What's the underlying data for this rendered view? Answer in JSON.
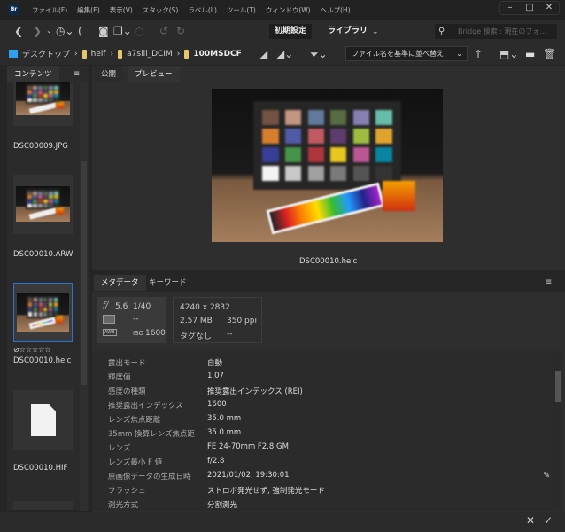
{
  "app": {
    "logo": "Br",
    "menu": [
      "ファイル(F)",
      "編集(E)",
      "表示(V)",
      "スタック(S)",
      "ラベル(L)",
      "ツール(T)",
      "ウィンドウ(W)",
      "ヘルプ(H)"
    ]
  },
  "toolbar": {
    "workspace_essentials": "初期設定",
    "workspace_library": "ライブラリ",
    "search_placeholder": "Bridge 検索 : 現在のフォ..."
  },
  "path": {
    "crumbs": [
      "デスクトップ",
      "heif",
      "a7siii_DCIM",
      "100MSDCF"
    ],
    "sort_label": "ファイル名を基準に並べ替え"
  },
  "content_panel": {
    "tab": "コンテンツ",
    "items": [
      {
        "name": "DSC00009.JPG"
      },
      {
        "name": "DSC00010.ARW"
      },
      {
        "name": "DSC00010.heic",
        "selected": true,
        "rating": "☆☆☆☆☆"
      },
      {
        "name": "DSC00010.HIF"
      }
    ]
  },
  "preview_panel": {
    "tabs": [
      "公開",
      "プレビュー"
    ],
    "filename": "DSC00010.heic"
  },
  "metadata_panel": {
    "tabs": [
      "メタデータ",
      "キーワード"
    ],
    "summary": {
      "aperture": "5.6",
      "shutter": "1/40",
      "metering": "--",
      "iso_label": "ISO",
      "iso": "1600",
      "dimensions": "4240 x 2832",
      "size": "2.57 MB",
      "resolution": "350 ppi",
      "tag": "タグなし",
      "tag_value": "--",
      "wb": "AWB"
    },
    "rows": [
      {
        "k": "露出モード",
        "v": "自動"
      },
      {
        "k": "輝度値",
        "v": "1.07"
      },
      {
        "k": "感度の種類",
        "v": "推奨露出インデックス (REI)"
      },
      {
        "k": "推奨露出インデックス",
        "v": "1600"
      },
      {
        "k": "レンズ焦点距離",
        "v": "35.0 mm"
      },
      {
        "k": "35mm 換算レンズ焦点距",
        "v": "35.0 mm"
      },
      {
        "k": "レンズ",
        "v": "FE 24-70mm F2.8 GM"
      },
      {
        "k": "レンズ最小 F 値",
        "v": "f/2.8"
      },
      {
        "k": "原画像データの生成日時",
        "v": "2021/01/02, 19:30:01"
      },
      {
        "k": "フラッシュ",
        "v": "ストロボ発光せず, 強制発光モード"
      },
      {
        "k": "測光方式",
        "v": "分割測光"
      }
    ]
  },
  "patch_colors": [
    "#735244",
    "#c29682",
    "#627a9d",
    "#576c43",
    "#8580b1",
    "#67bdaa",
    "#d67e2c",
    "#505ba6",
    "#c15a63",
    "#5e3c6c",
    "#9dbc40",
    "#e0a32e",
    "#383d96",
    "#469449",
    "#af363c",
    "#e7c71f",
    "#bb5695",
    "#0885a1",
    "#f3f3f2",
    "#c8c8c8",
    "#a0a0a0",
    "#7a7a79",
    "#555555",
    "#343434"
  ]
}
